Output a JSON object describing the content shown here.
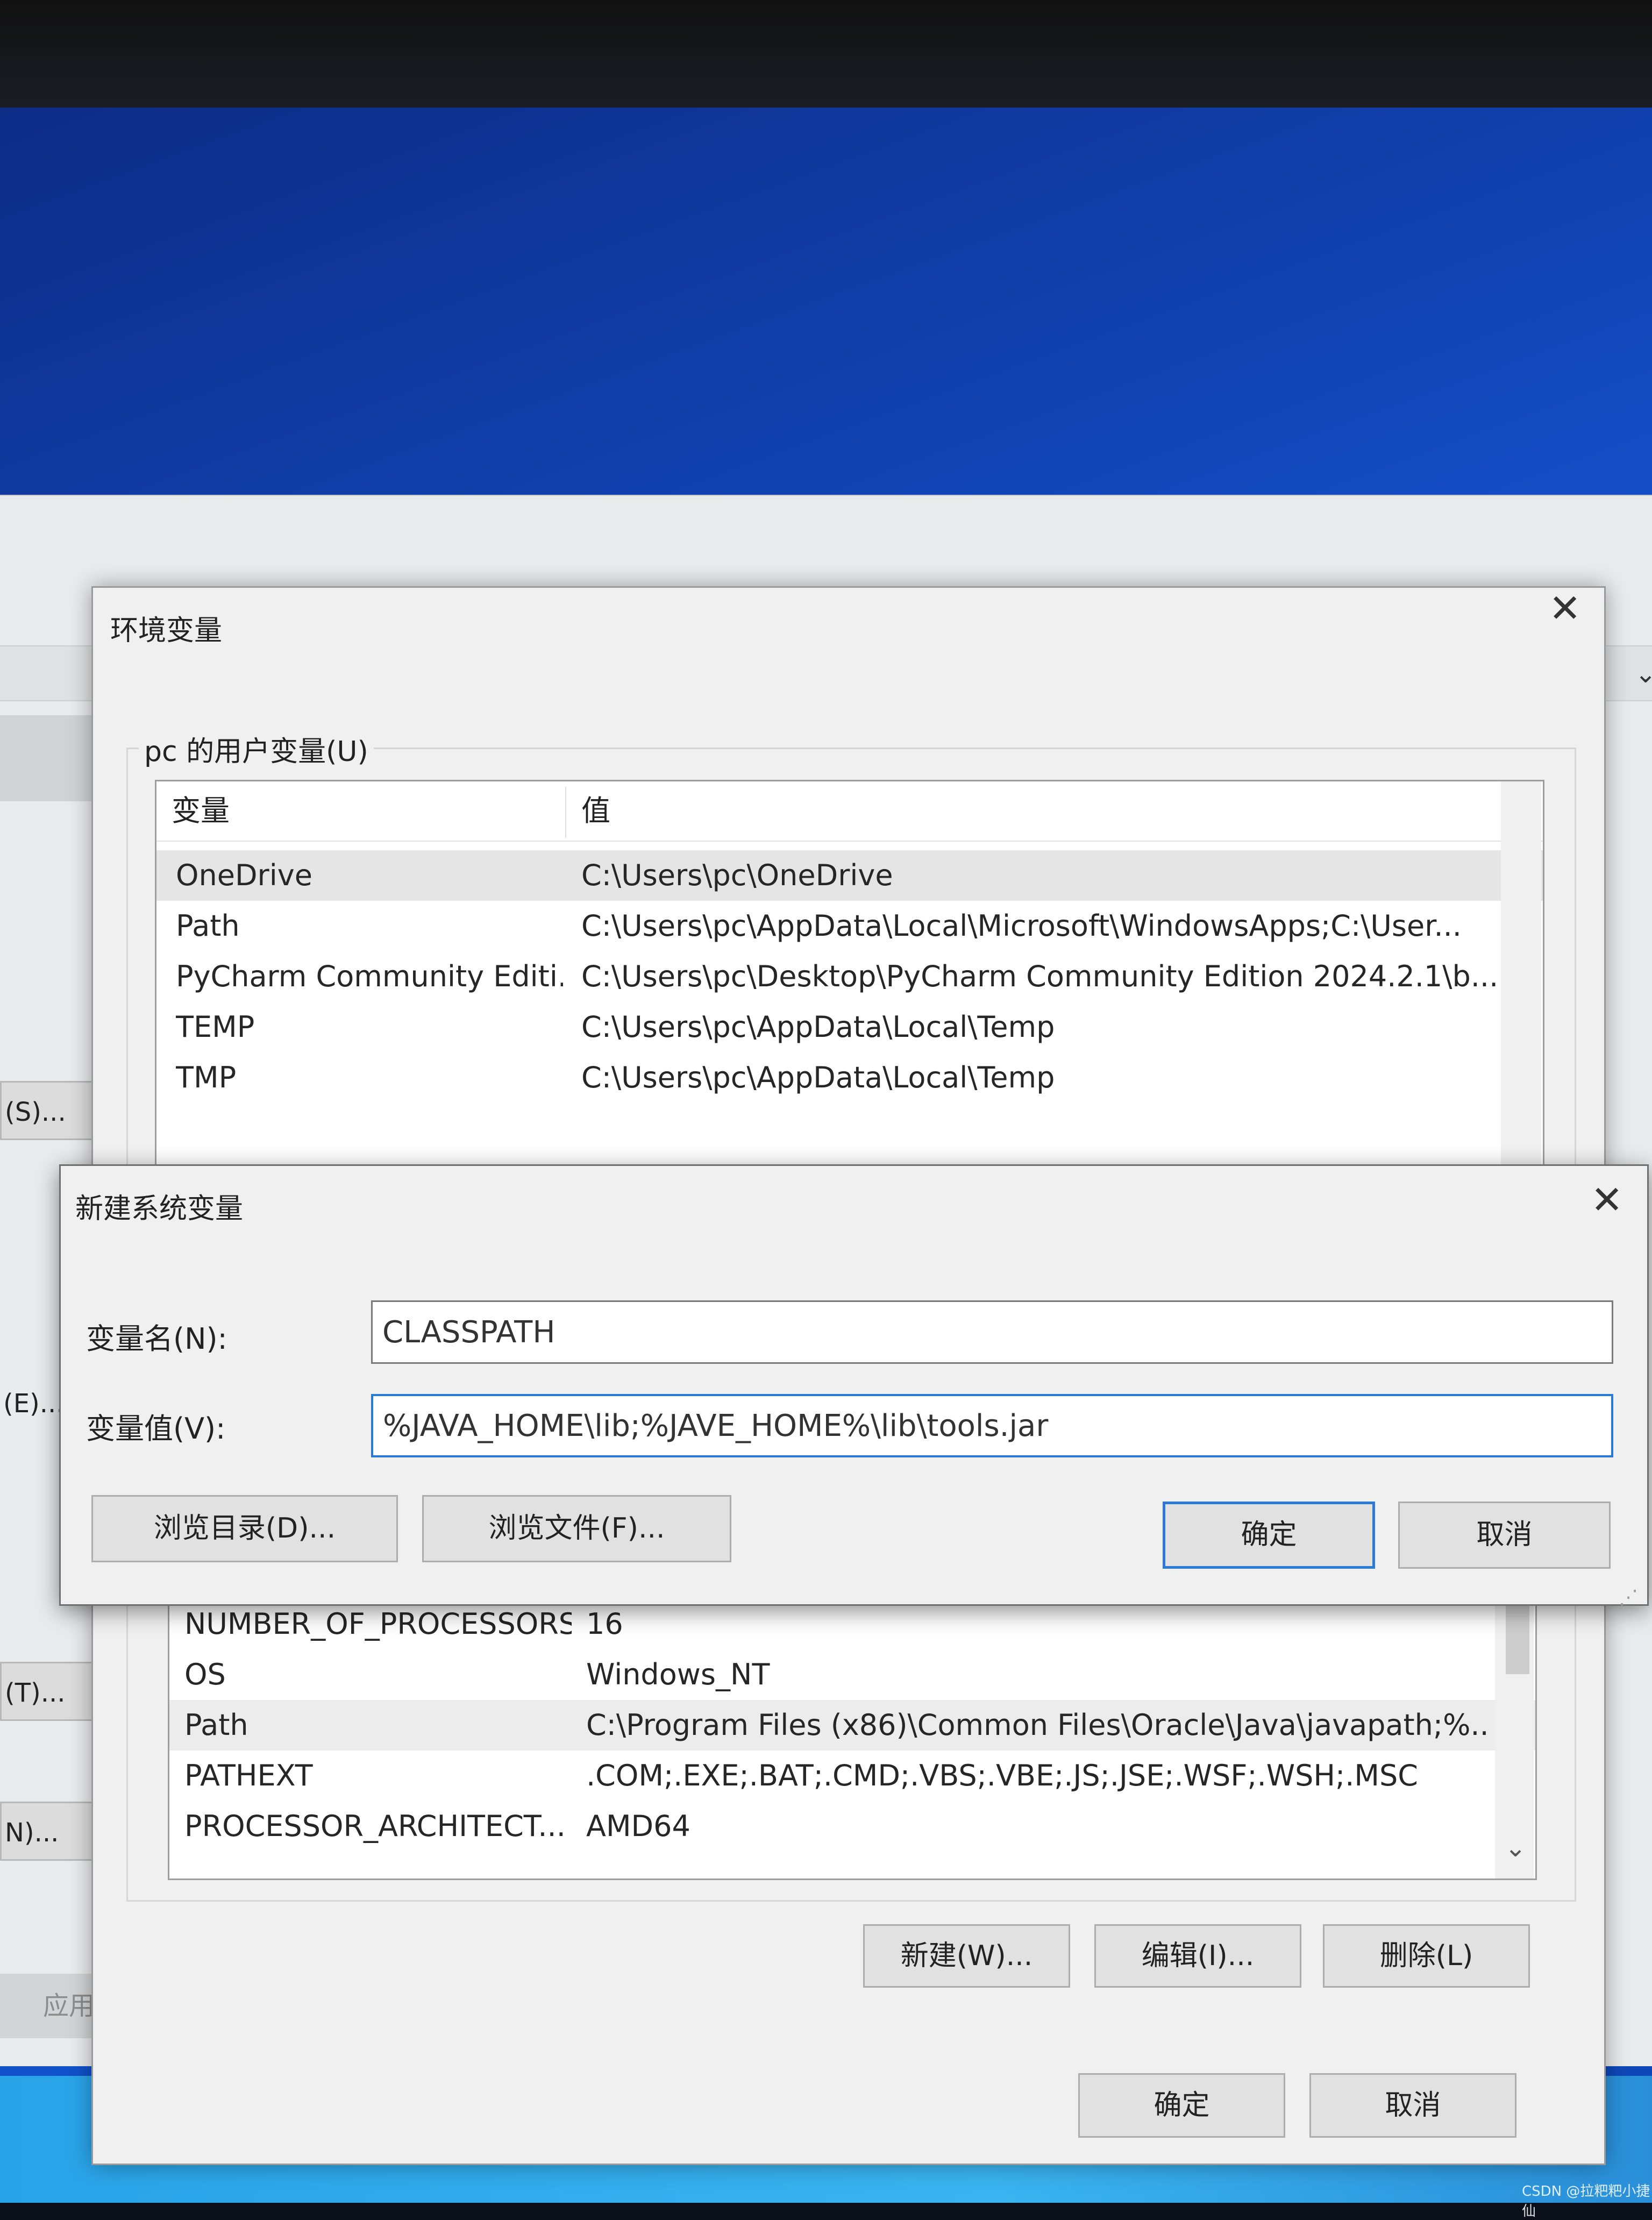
{
  "background_window": {
    "buttons": [
      "(S)...",
      "(E)...",
      "(T)...",
      "N)...",
      "应用("
    ]
  },
  "env_dialog": {
    "title": "环境变量",
    "user_group_label": "pc 的用户变量(U)",
    "columns": [
      "变量",
      "值"
    ],
    "user_vars": [
      {
        "name": "OneDrive",
        "value": "C:\\Users\\pc\\OneDrive"
      },
      {
        "name": "Path",
        "value": "C:\\Users\\pc\\AppData\\Local\\Microsoft\\WindowsApps;C:\\User..."
      },
      {
        "name": "PyCharm Community Editi...",
        "value": "C:\\Users\\pc\\Desktop\\PyCharm Community Edition 2024.2.1\\b..."
      },
      {
        "name": "TEMP",
        "value": "C:\\Users\\pc\\AppData\\Local\\Temp"
      },
      {
        "name": "TMP",
        "value": "C:\\Users\\pc\\AppData\\Local\\Temp"
      }
    ],
    "system_vars": [
      {
        "name": "NUMBER_OF_PROCESSORS",
        "value": "16"
      },
      {
        "name": "OS",
        "value": "Windows_NT"
      },
      {
        "name": "Path",
        "value": "C:\\Program Files (x86)\\Common Files\\Oracle\\Java\\javapath;%..."
      },
      {
        "name": "PATHEXT",
        "value": ".COM;.EXE;.BAT;.CMD;.VBS;.VBE;.JS;.JSE;.WSF;.WSH;.MSC"
      },
      {
        "name": "PROCESSOR_ARCHITECT...",
        "value": "AMD64"
      }
    ],
    "system_buttons": {
      "new": "新建(W)...",
      "edit": "编辑(I)...",
      "delete": "删除(L)"
    },
    "ok": "确定",
    "cancel": "取消"
  },
  "new_var_dialog": {
    "title": "新建系统变量",
    "name_label": "变量名(N):",
    "name_value": "CLASSPATH",
    "value_label": "变量值(V):",
    "value_value": "%JAVA_HOME\\lib;%JAVE_HOME%\\lib\\tools.jar",
    "browse_dir": "浏览目录(D)...",
    "browse_file": "浏览文件(F)...",
    "ok": "确定",
    "cancel": "取消"
  },
  "icons": {
    "close": "close-icon",
    "scroll_down": "chevron-down-icon",
    "grip": "resize-grip-icon"
  },
  "colors": {
    "focus_border": "#2b7ad4",
    "dialog_bg": "#f0f0f0",
    "desktop": "#134cc4"
  },
  "watermark": "CSDN @拉粑粑小捷仙"
}
